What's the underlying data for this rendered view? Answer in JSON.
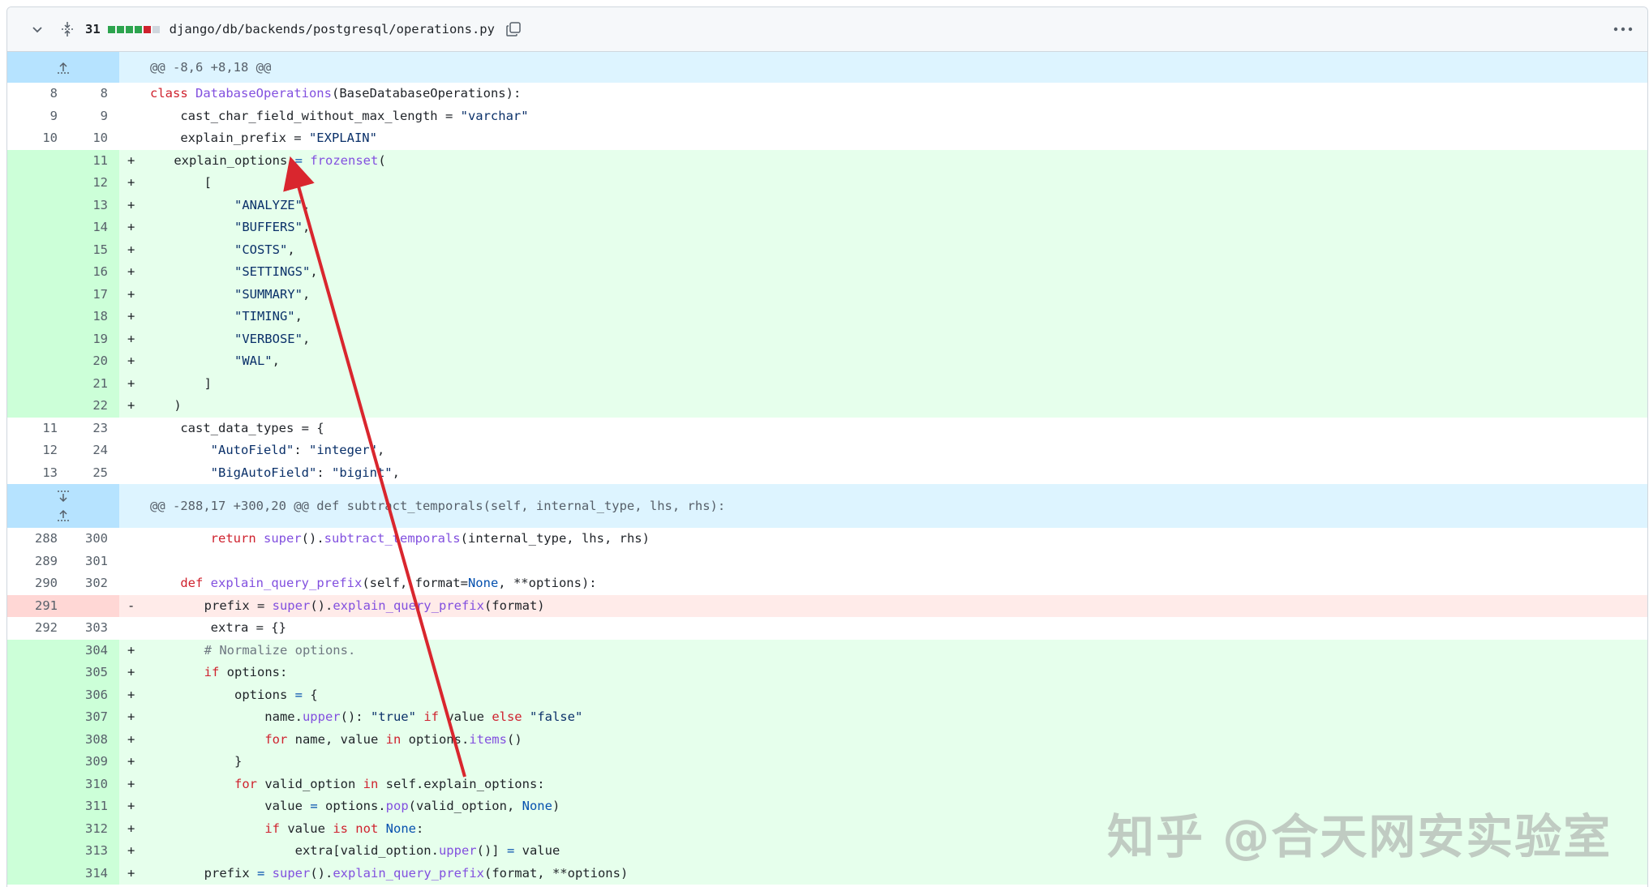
{
  "file": {
    "changed_count": "31",
    "path": "django/db/backends/postgresql/operations.py",
    "stat_colors": [
      "#2da44e",
      "#2da44e",
      "#2da44e",
      "#2da44e",
      "#cf222e",
      "#d0d7de"
    ]
  },
  "hunk1": {
    "header": "@@ -8,6 +8,18 @@"
  },
  "hunk2": {
    "header": "@@ -288,17 +300,20 @@ def subtract_temporals(self, internal_type, lhs, rhs):"
  },
  "lines": [
    {
      "old": "8",
      "new": "8",
      "mark": "",
      "type": "ctx"
    },
    {
      "old": "9",
      "new": "9",
      "mark": "",
      "type": "ctx"
    },
    {
      "old": "10",
      "new": "10",
      "mark": "",
      "type": "ctx"
    },
    {
      "old": "",
      "new": "11",
      "mark": "+",
      "type": "add"
    },
    {
      "old": "",
      "new": "12",
      "mark": "+",
      "type": "add"
    },
    {
      "old": "",
      "new": "13",
      "mark": "+",
      "type": "add"
    },
    {
      "old": "",
      "new": "14",
      "mark": "+",
      "type": "add"
    },
    {
      "old": "",
      "new": "15",
      "mark": "+",
      "type": "add"
    },
    {
      "old": "",
      "new": "16",
      "mark": "+",
      "type": "add"
    },
    {
      "old": "",
      "new": "17",
      "mark": "+",
      "type": "add"
    },
    {
      "old": "",
      "new": "18",
      "mark": "+",
      "type": "add"
    },
    {
      "old": "",
      "new": "19",
      "mark": "+",
      "type": "add"
    },
    {
      "old": "",
      "new": "20",
      "mark": "+",
      "type": "add"
    },
    {
      "old": "",
      "new": "21",
      "mark": "+",
      "type": "add"
    },
    {
      "old": "",
      "new": "22",
      "mark": "+",
      "type": "add"
    },
    {
      "old": "11",
      "new": "23",
      "mark": "",
      "type": "ctx"
    },
    {
      "old": "12",
      "new": "24",
      "mark": "",
      "type": "ctx"
    },
    {
      "old": "13",
      "new": "25",
      "mark": "",
      "type": "ctx"
    },
    {
      "old": "288",
      "new": "300",
      "mark": "",
      "type": "ctx"
    },
    {
      "old": "289",
      "new": "301",
      "mark": "",
      "type": "ctx"
    },
    {
      "old": "290",
      "new": "302",
      "mark": "",
      "type": "ctx"
    },
    {
      "old": "291",
      "new": "",
      "mark": "-",
      "type": "del"
    },
    {
      "old": "292",
      "new": "303",
      "mark": "",
      "type": "ctx"
    },
    {
      "old": "",
      "new": "304",
      "mark": "+",
      "type": "add"
    },
    {
      "old": "",
      "new": "305",
      "mark": "+",
      "type": "add"
    },
    {
      "old": "",
      "new": "306",
      "mark": "+",
      "type": "add"
    },
    {
      "old": "",
      "new": "307",
      "mark": "+",
      "type": "add"
    },
    {
      "old": "",
      "new": "308",
      "mark": "+",
      "type": "add"
    },
    {
      "old": "",
      "new": "309",
      "mark": "+",
      "type": "add"
    },
    {
      "old": "",
      "new": "310",
      "mark": "+",
      "type": "add"
    },
    {
      "old": "",
      "new": "311",
      "mark": "+",
      "type": "add"
    },
    {
      "old": "",
      "new": "312",
      "mark": "+",
      "type": "add"
    },
    {
      "old": "",
      "new": "313",
      "mark": "+",
      "type": "add"
    },
    {
      "old": "",
      "new": "314",
      "mark": "+",
      "type": "add"
    }
  ],
  "code": {
    "l0": {
      "a": "class ",
      "b": "DatabaseOperations",
      "c": "(BaseDatabaseOperations):"
    },
    "l1": {
      "a": "    cast_char_field_without_max_length = ",
      "b": "\"varchar\""
    },
    "l2": {
      "a": "    explain_prefix = ",
      "b": "\"EXPLAIN\""
    },
    "l3": {
      "a": "    explain_options ",
      "b": "=",
      "c": " ",
      "d": "frozenset",
      "e": "("
    },
    "l4": {
      "a": "        ["
    },
    "l5": {
      "a": "            ",
      "b": "\"ANALYZE\"",
      "c": ","
    },
    "l6": {
      "a": "            ",
      "b": "\"BUFFERS\"",
      "c": ","
    },
    "l7": {
      "a": "            ",
      "b": "\"COSTS\"",
      "c": ","
    },
    "l8": {
      "a": "            ",
      "b": "\"SETTINGS\"",
      "c": ","
    },
    "l9": {
      "a": "            ",
      "b": "\"SUMMARY\"",
      "c": ","
    },
    "l10": {
      "a": "            ",
      "b": "\"TIMING\"",
      "c": ","
    },
    "l11": {
      "a": "            ",
      "b": "\"VERBOSE\"",
      "c": ","
    },
    "l12": {
      "a": "            ",
      "b": "\"WAL\"",
      "c": ","
    },
    "l13": {
      "a": "        ]"
    },
    "l14": {
      "a": "    )"
    },
    "l15": {
      "a": "    cast_data_types = {"
    },
    "l16": {
      "a": "        ",
      "b": "\"AutoField\"",
      "c": ": ",
      "d": "\"integer\"",
      "e": ","
    },
    "l17": {
      "a": "        ",
      "b": "\"BigAutoField\"",
      "c": ": ",
      "d": "\"bigint\"",
      "e": ","
    },
    "l18": {
      "a": "        ",
      "b": "return",
      "c": " ",
      "d": "super",
      "e": "().",
      "f": "subtract_temporals",
      "g": "(internal_type, lhs, rhs)"
    },
    "l19": {
      "a": ""
    },
    "l20": {
      "a": "    ",
      "b": "def",
      "c": " ",
      "d": "explain_query_prefix",
      "e": "(self, format=",
      "f": "None",
      "g": ", **options):"
    },
    "l21": {
      "a": "        prefix = ",
      "b": "super",
      "c": "().",
      "d": "explain_query_prefix",
      "e": "(format)"
    },
    "l22": {
      "a": "        extra = {}"
    },
    "l23": {
      "a": "        ",
      "b": "# Normalize options."
    },
    "l24": {
      "a": "        ",
      "b": "if",
      "c": " options:"
    },
    "l25": {
      "a": "            options ",
      "b": "=",
      "c": " {"
    },
    "l26": {
      "a": "                name.",
      "b": "upper",
      "c": "(): ",
      "d": "\"true\"",
      "e": " ",
      "f": "if",
      "g": " value ",
      "h": "else",
      "i": " ",
      "j": "\"false\""
    },
    "l27": {
      "a": "                ",
      "b": "for",
      "c": " name, value ",
      "d": "in",
      "e": " options.",
      "f": "items",
      "g": "()"
    },
    "l28": {
      "a": "            }"
    },
    "l29": {
      "a": "            ",
      "b": "for",
      "c": " valid_option ",
      "d": "in",
      "e": " self.explain_options:"
    },
    "l30": {
      "a": "                value ",
      "b": "=",
      "c": " options.",
      "d": "pop",
      "e": "(valid_option, ",
      "f": "None",
      "g": ")"
    },
    "l31": {
      "a": "                ",
      "b": "if",
      "c": " value ",
      "d": "is not",
      "e": " ",
      "f": "None",
      "g": ":"
    },
    "l32": {
      "a": "                    extra[valid_option.",
      "b": "upper",
      "c": "()] ",
      "d": "=",
      "e": " value"
    },
    "l33": {
      "a": "        prefix ",
      "b": "=",
      "c": " ",
      "d": "super",
      "e": "().",
      "f": "explain_query_prefix",
      "g": "(format, **options)"
    }
  },
  "watermark": "知乎 @合天网安实验室",
  "colors": {
    "add_bg": "#e6ffec",
    "del_bg": "#ffebe9",
    "hunk_bg": "#ddf4ff",
    "arrow": "#d9262e"
  }
}
